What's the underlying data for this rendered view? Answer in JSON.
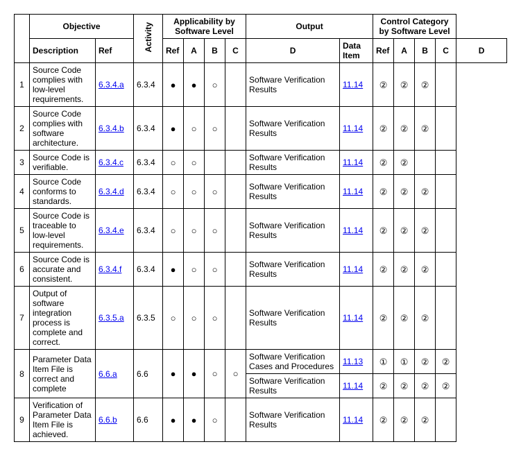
{
  "headers": {
    "objective": "Objective",
    "activity": "Activity",
    "applicability": "Applicability by Software Level",
    "output": "Output",
    "control": "Control Category by Software Level",
    "description": "Description",
    "ref": "Ref",
    "dataitem": "Data Item",
    "A": "A",
    "B": "B",
    "C": "C",
    "D": "D"
  },
  "symbols": {
    "filled": "●",
    "hollow": "○",
    "c1": "①",
    "c2": "②"
  },
  "rows": [
    {
      "num": "1",
      "desc": "Source Code complies with low-level requirements.",
      "ref": "6.3.4.a",
      "act": "6.3.4",
      "app": [
        "filled",
        "filled",
        "hollow",
        ""
      ],
      "outputs": [
        {
          "item": "Software Verification Results",
          "ref": "11.14",
          "cat": [
            "c2",
            "c2",
            "c2",
            ""
          ]
        }
      ]
    },
    {
      "num": "2",
      "desc": "Source Code complies with software architecture.",
      "ref": "6.3.4.b",
      "act": "6.3.4",
      "app": [
        "filled",
        "hollow",
        "hollow",
        ""
      ],
      "outputs": [
        {
          "item": "Software Verification Results",
          "ref": "11.14",
          "cat": [
            "c2",
            "c2",
            "c2",
            ""
          ]
        }
      ]
    },
    {
      "num": "3",
      "desc": "Source Code is verifiable.",
      "ref": "6.3.4.c",
      "act": "6.3.4",
      "app": [
        "hollow",
        "hollow",
        "",
        ""
      ],
      "outputs": [
        {
          "item": "Software Verification Results",
          "ref": "11.14",
          "cat": [
            "c2",
            "c2",
            "",
            ""
          ]
        }
      ]
    },
    {
      "num": "4",
      "desc": "Source Code conforms to standards.",
      "ref": "6.3.4.d",
      "act": "6.3.4",
      "app": [
        "hollow",
        "hollow",
        "hollow",
        ""
      ],
      "outputs": [
        {
          "item": "Software Verification Results",
          "ref": "11.14",
          "cat": [
            "c2",
            "c2",
            "c2",
            ""
          ]
        }
      ]
    },
    {
      "num": "5",
      "desc": "Source Code is traceable to low-level requirements.",
      "ref": "6.3.4.e",
      "act": "6.3.4",
      "app": [
        "hollow",
        "hollow",
        "hollow",
        ""
      ],
      "outputs": [
        {
          "item": "Software Verification Results",
          "ref": "11.14",
          "cat": [
            "c2",
            "c2",
            "c2",
            ""
          ]
        }
      ]
    },
    {
      "num": "6",
      "desc": "Source Code is accurate and consistent.",
      "ref": "6.3.4.f",
      "act": "6.3.4",
      "app": [
        "filled",
        "hollow",
        "hollow",
        ""
      ],
      "outputs": [
        {
          "item": "Software Verification Results",
          "ref": "11.14",
          "cat": [
            "c2",
            "c2",
            "c2",
            ""
          ]
        }
      ]
    },
    {
      "num": "7",
      "desc": "Output of software integration process is complete and correct.",
      "ref": "6.3.5.a",
      "act": "6.3.5",
      "app": [
        "hollow",
        "hollow",
        "hollow",
        ""
      ],
      "outputs": [
        {
          "item": "Software Verification Results",
          "ref": "11.14",
          "cat": [
            "c2",
            "c2",
            "c2",
            ""
          ]
        }
      ]
    },
    {
      "num": "8",
      "desc": "Parameter Data Item File is correct and complete",
      "ref": "6.6.a",
      "act": "6.6",
      "app": [
        "filled",
        "filled",
        "hollow",
        "hollow"
      ],
      "outputs": [
        {
          "item": "Software Verification Cases and Procedures",
          "ref": "11.13",
          "cat": [
            "c1",
            "c1",
            "c2",
            "c2"
          ]
        },
        {
          "item": "Software Verification Results",
          "ref": "11.14",
          "cat": [
            "c2",
            "c2",
            "c2",
            "c2"
          ]
        }
      ]
    },
    {
      "num": "9",
      "desc": "Verification of Parameter Data Item File is achieved.",
      "ref": "6.6.b",
      "act": "6.6",
      "app": [
        "filled",
        "filled",
        "hollow",
        ""
      ],
      "outputs": [
        {
          "item": "Software Verification Results",
          "ref": "11.14",
          "cat": [
            "c2",
            "c2",
            "c2",
            ""
          ]
        }
      ]
    }
  ]
}
